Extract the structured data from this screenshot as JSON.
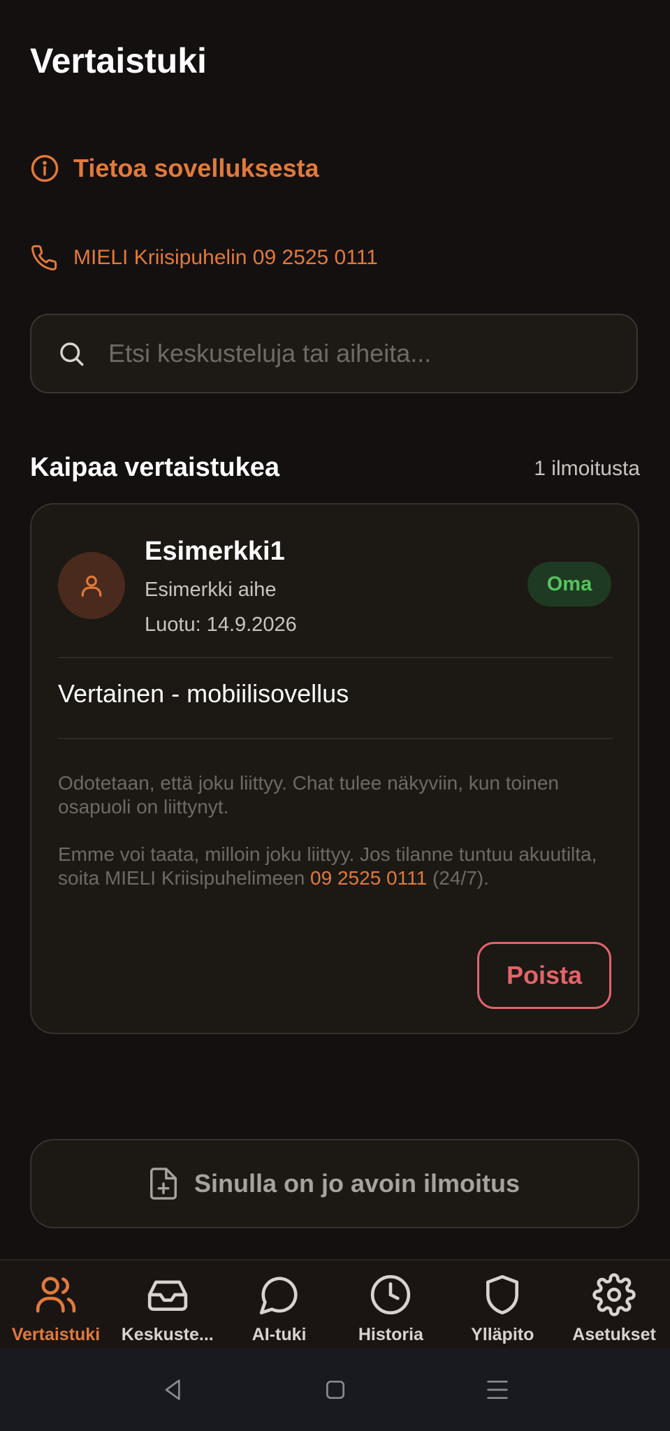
{
  "header": {
    "title": "Vertaistuki"
  },
  "about": {
    "label": "Tietoa sovelluksesta",
    "icon": "info-icon"
  },
  "crisis": {
    "label": "MIELI Kriisipuhelin 09 2525 0111",
    "icon": "phone-icon"
  },
  "search": {
    "placeholder": "Etsi keskusteluja tai aiheita...",
    "value": ""
  },
  "section": {
    "title": "Kaipaa vertaistukea",
    "count": "1 ilmoitusta"
  },
  "card": {
    "name": "Esimerkki1",
    "topic": "Esimerkki aihe",
    "created": "Luotu: 14.9.2026",
    "badge": "Oma",
    "app": "Vertainen - mobiilisovellus",
    "info1": "Odotetaan, että joku liittyy. Chat tulee näkyviin, kun toinen osapuoli on liittynyt.",
    "info2_pre": "Emme voi taata, milloin joku liittyy. Jos tilanne tuntuu akuutilta, soita MIELI Kriisipuhelimeen ",
    "info2_number": "09 2525 0111",
    "info2_post": " (24/7).",
    "delete_label": "Poista"
  },
  "open_notice": {
    "label": "Sinulla on jo avoin ilmoitus"
  },
  "nav": {
    "items": [
      {
        "label": "Vertaistuki",
        "icon": "users-icon",
        "active": true
      },
      {
        "label": "Keskuste...",
        "icon": "inbox-icon",
        "active": false
      },
      {
        "label": "AI-tuki",
        "icon": "chat-bubble-icon",
        "active": false
      },
      {
        "label": "Historia",
        "icon": "clock-icon",
        "active": false
      },
      {
        "label": "Ylläpito",
        "icon": "shield-icon",
        "active": false
      },
      {
        "label": "Asetukset",
        "icon": "gear-icon",
        "active": false
      }
    ]
  },
  "colors": {
    "accent": "#e07a3c",
    "danger": "#e2646a",
    "badge_text": "#56c25e",
    "background": "#141010"
  }
}
